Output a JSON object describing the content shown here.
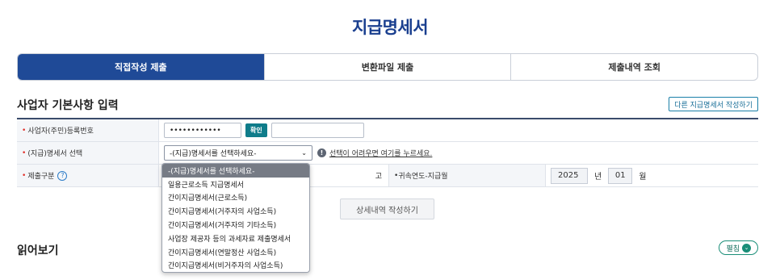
{
  "page_title": "지급명세서",
  "tabs": [
    {
      "label": "직접작성 제출",
      "active": true
    },
    {
      "label": "변환파일 제출",
      "active": false
    },
    {
      "label": "제출내역 조회",
      "active": false
    }
  ],
  "section": {
    "title": "사업자 기본사항 입력",
    "other_button": "다른 지급명세서 작성하기"
  },
  "form": {
    "row1": {
      "label": "사업자(주민)등록번호",
      "masked_value": "••••••••••••",
      "confirm_button": "확인",
      "result_value": ""
    },
    "row2": {
      "label": "(지급)명세서 선택",
      "select_value": "-(지급)명세서를 선택하세요-",
      "info_link": "선택이 어려우면 여기를 누르세요."
    },
    "row3": {
      "label": "제출구분",
      "help": "?",
      "partial_text": "고",
      "period_label": "귀속연도-지급월",
      "year": "2025",
      "year_unit": "년",
      "month": "01",
      "month_unit": "월"
    }
  },
  "detail_button": "상세내역 작성하기",
  "read_section": {
    "title": "읽어보기",
    "expand_button": "펼침"
  },
  "dropdown": {
    "options": [
      "-(지급)명세서를 선택하세요-",
      "일용근로소득 지급명세서",
      "간이지급명세서(근로소득)",
      "간이지급명세서(거주자의 사업소득)",
      "간이지급명세서(거주자의 기타소득)",
      "사업장 제공자 등의 과세자료 제출명세서",
      "간이지급명세서(연말정산 사업소득)",
      "간이지급명세서(비거주자의 사업소득)"
    ],
    "selected_index": 0
  },
  "colors": {
    "primary": "#1f4a97",
    "title": "#1a3f8f",
    "confirm": "#0f7c8a",
    "required": "#e0302a"
  }
}
